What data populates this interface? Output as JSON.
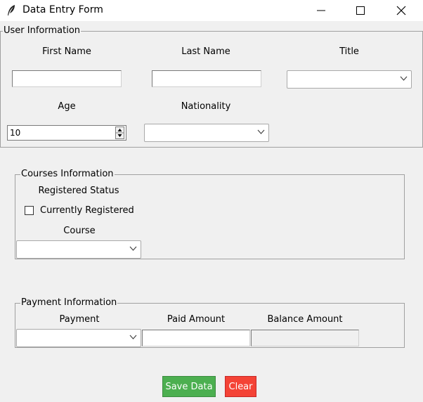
{
  "window": {
    "title": "Data Entry Form"
  },
  "user_info": {
    "group_title": "User Information",
    "first_name_label": "First Name",
    "last_name_label": "Last Name",
    "title_label": "Title",
    "age_label": "Age",
    "nationality_label": "Nationality",
    "first_name_value": "",
    "last_name_value": "",
    "title_value": "",
    "age_value": "10",
    "nationality_value": ""
  },
  "courses_info": {
    "group_title": "Courses Information",
    "registered_status_label": "Registered Status",
    "currently_registered_label": "Currently Registered",
    "course_label": "Course",
    "course_value": ""
  },
  "payment_info": {
    "group_title": "Payment Information",
    "payment_label": "Payment",
    "paid_amount_label": "Paid Amount",
    "balance_amount_label": "Balance Amount",
    "payment_value": "",
    "paid_amount_value": "",
    "balance_amount_value": ""
  },
  "actions": {
    "save_label": "Save Data",
    "clear_label": "Clear",
    "save_color": "#4caf50",
    "clear_color": "#f44336"
  }
}
